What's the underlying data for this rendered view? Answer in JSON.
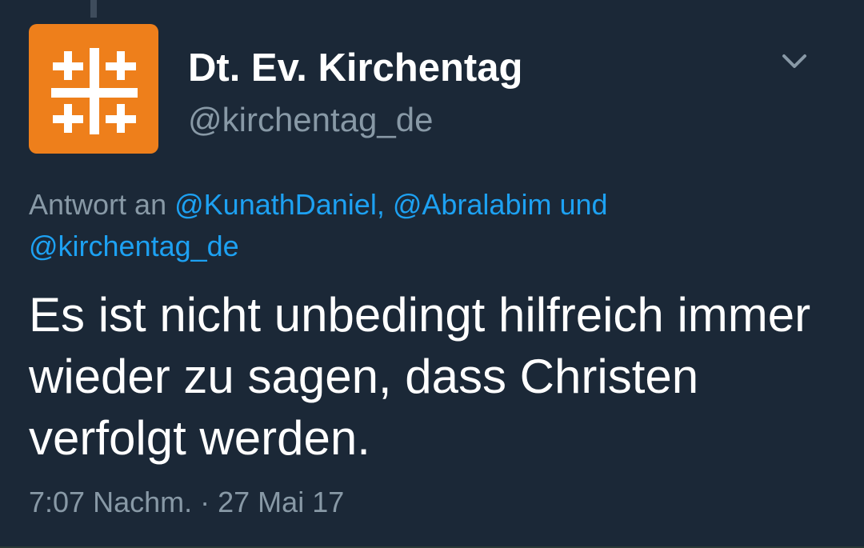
{
  "account": {
    "display_name": "Dt. Ev. Kirchentag",
    "handle": "@kirchentag_de",
    "avatar_color": "#ee7f1b",
    "avatar_icon": "kirchentag-cross-logo"
  },
  "menu": {
    "icon": "chevron-down-icon"
  },
  "reply": {
    "prefix": "Antwort an",
    "mention_1": "@KunathDaniel,",
    "mention_2": "@Abralabim und",
    "mention_3": "@kirchentag_de"
  },
  "tweet": {
    "text": "Es ist nicht unbedingt hilfreich immer wieder zu sagen, dass Christen verfolgt werden.",
    "time": "7:07 Nachm.",
    "separator": "·",
    "date": "27 Mai 17"
  },
  "colors": {
    "background": "#1b2837",
    "text": "#ffffff",
    "secondary": "#8899a6",
    "link": "#1da1f2"
  }
}
